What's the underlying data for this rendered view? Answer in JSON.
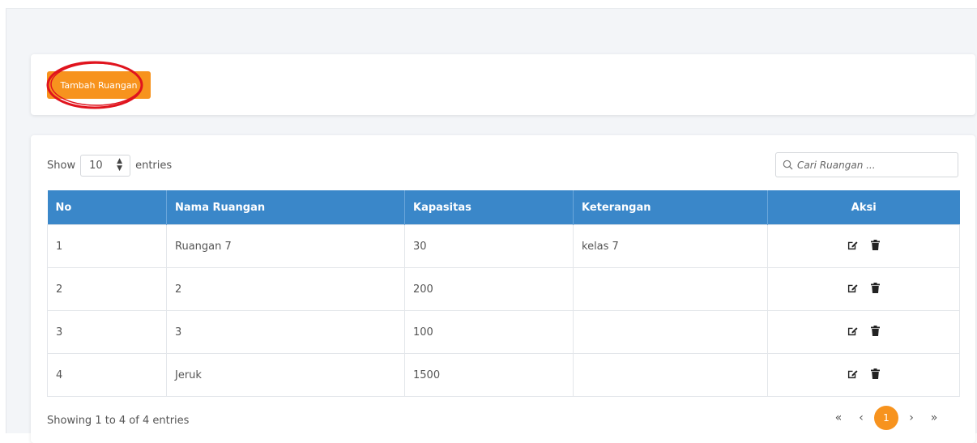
{
  "toolbar": {
    "add_label": "Tambah Ruangan"
  },
  "length_control": {
    "show_label": "Show",
    "value": "10",
    "entries_label": "entries"
  },
  "search": {
    "placeholder": "Cari Ruangan ..."
  },
  "table": {
    "headers": {
      "no": "No",
      "nama": "Nama Ruangan",
      "kapasitas": "Kapasitas",
      "keterangan": "Keterangan",
      "aksi": "Aksi"
    },
    "rows": [
      {
        "no": "1",
        "nama": "Ruangan 7",
        "kapasitas": "30",
        "keterangan": "kelas 7"
      },
      {
        "no": "2",
        "nama": "2",
        "kapasitas": "200",
        "keterangan": ""
      },
      {
        "no": "3",
        "nama": "3",
        "kapasitas": "100",
        "keterangan": ""
      },
      {
        "no": "4",
        "nama": "Jeruk",
        "kapasitas": "1500",
        "keterangan": ""
      }
    ]
  },
  "footer": {
    "info": "Showing 1 to 4 of 4 entries"
  },
  "pagination": {
    "first": "«",
    "prev": "‹",
    "current": "1",
    "next": "›",
    "last": "»"
  },
  "colors": {
    "accent": "#f7931e",
    "header_bg": "#3a87c9",
    "annotation": "#e0141e"
  },
  "icons": {
    "row_actions": [
      "edit-icon",
      "trash-icon"
    ],
    "search": "search-icon"
  }
}
